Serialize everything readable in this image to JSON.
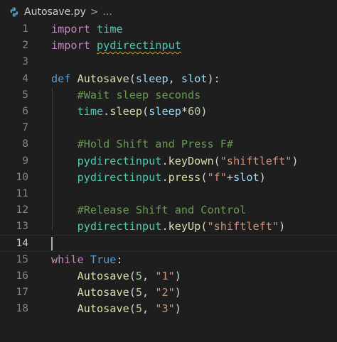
{
  "breadcrumb": {
    "filename": "Autosave.py",
    "separator": ">",
    "more": "..."
  },
  "editor": {
    "active_line": 14,
    "lines": [
      {
        "n": "1",
        "tokens": [
          [
            "kw",
            "import"
          ],
          [
            "plain",
            " "
          ],
          [
            "mod",
            "time"
          ]
        ]
      },
      {
        "n": "2",
        "tokens": [
          [
            "kw",
            "import"
          ],
          [
            "plain",
            " "
          ],
          [
            "mod squiggle",
            "pydirectinput"
          ]
        ]
      },
      {
        "n": "3",
        "tokens": []
      },
      {
        "n": "4",
        "tokens": [
          [
            "def",
            "def"
          ],
          [
            "plain",
            " "
          ],
          [
            "fn",
            "Autosave"
          ],
          [
            "plain",
            "("
          ],
          [
            "var",
            "sleep"
          ],
          [
            "plain",
            ", "
          ],
          [
            "var",
            "slot"
          ],
          [
            "plain",
            "):"
          ]
        ]
      },
      {
        "n": "5",
        "tokens": [
          [
            "plain",
            "    "
          ],
          [
            "cmt",
            "#Wait sleep seconds"
          ]
        ]
      },
      {
        "n": "6",
        "tokens": [
          [
            "plain",
            "    "
          ],
          [
            "mod",
            "time"
          ],
          [
            "plain",
            "."
          ],
          [
            "fn",
            "sleep"
          ],
          [
            "plain",
            "("
          ],
          [
            "var",
            "sleep"
          ],
          [
            "plain",
            "*"
          ],
          [
            "num",
            "60"
          ],
          [
            "plain",
            ")"
          ]
        ]
      },
      {
        "n": "7",
        "tokens": []
      },
      {
        "n": "8",
        "tokens": [
          [
            "plain",
            "    "
          ],
          [
            "cmt",
            "#Hold Shift and Press F#"
          ]
        ]
      },
      {
        "n": "9",
        "tokens": [
          [
            "plain",
            "    "
          ],
          [
            "mod",
            "pydirectinput"
          ],
          [
            "plain",
            "."
          ],
          [
            "fn",
            "keyDown"
          ],
          [
            "plain",
            "("
          ],
          [
            "str",
            "\"shiftleft\""
          ],
          [
            "plain",
            ")"
          ]
        ]
      },
      {
        "n": "10",
        "tokens": [
          [
            "plain",
            "    "
          ],
          [
            "mod",
            "pydirectinput"
          ],
          [
            "plain",
            "."
          ],
          [
            "fn",
            "press"
          ],
          [
            "plain",
            "("
          ],
          [
            "str",
            "\"f\""
          ],
          [
            "plain",
            "+"
          ],
          [
            "var",
            "slot"
          ],
          [
            "plain",
            ")"
          ]
        ]
      },
      {
        "n": "11",
        "tokens": []
      },
      {
        "n": "12",
        "tokens": [
          [
            "plain",
            "    "
          ],
          [
            "cmt",
            "#Release Shift and Control"
          ]
        ]
      },
      {
        "n": "13",
        "tokens": [
          [
            "plain",
            "    "
          ],
          [
            "mod",
            "pydirectinput"
          ],
          [
            "plain",
            "."
          ],
          [
            "fn",
            "keyUp"
          ],
          [
            "plain",
            "("
          ],
          [
            "str",
            "\"shiftleft\""
          ],
          [
            "plain",
            ")"
          ]
        ]
      },
      {
        "n": "14",
        "tokens": []
      },
      {
        "n": "15",
        "tokens": [
          [
            "kw",
            "while"
          ],
          [
            "plain",
            " "
          ],
          [
            "bool",
            "True"
          ],
          [
            "plain",
            ":"
          ]
        ]
      },
      {
        "n": "16",
        "tokens": [
          [
            "plain",
            "    "
          ],
          [
            "fn",
            "Autosave"
          ],
          [
            "plain",
            "("
          ],
          [
            "num",
            "5"
          ],
          [
            "plain",
            ", "
          ],
          [
            "str",
            "\"1\""
          ],
          [
            "plain",
            ")"
          ]
        ]
      },
      {
        "n": "17",
        "tokens": [
          [
            "plain",
            "    "
          ],
          [
            "fn",
            "Autosave"
          ],
          [
            "plain",
            "("
          ],
          [
            "num",
            "5"
          ],
          [
            "plain",
            ", "
          ],
          [
            "str",
            "\"2\""
          ],
          [
            "plain",
            ")"
          ]
        ]
      },
      {
        "n": "18",
        "tokens": [
          [
            "plain",
            "    "
          ],
          [
            "fn",
            "Autosave"
          ],
          [
            "plain",
            "("
          ],
          [
            "num",
            "5"
          ],
          [
            "plain",
            ", "
          ],
          [
            "str",
            "\"3\""
          ],
          [
            "plain",
            ")"
          ]
        ]
      }
    ]
  },
  "icons": {
    "file_type": "python-file-icon"
  },
  "colors": {
    "background": "#1e1e1e",
    "keyword": "#c586c0",
    "function": "#dcdcaa",
    "module": "#4ec9b0",
    "string": "#ce9178",
    "comment": "#6a9955",
    "number": "#b5cea8"
  }
}
